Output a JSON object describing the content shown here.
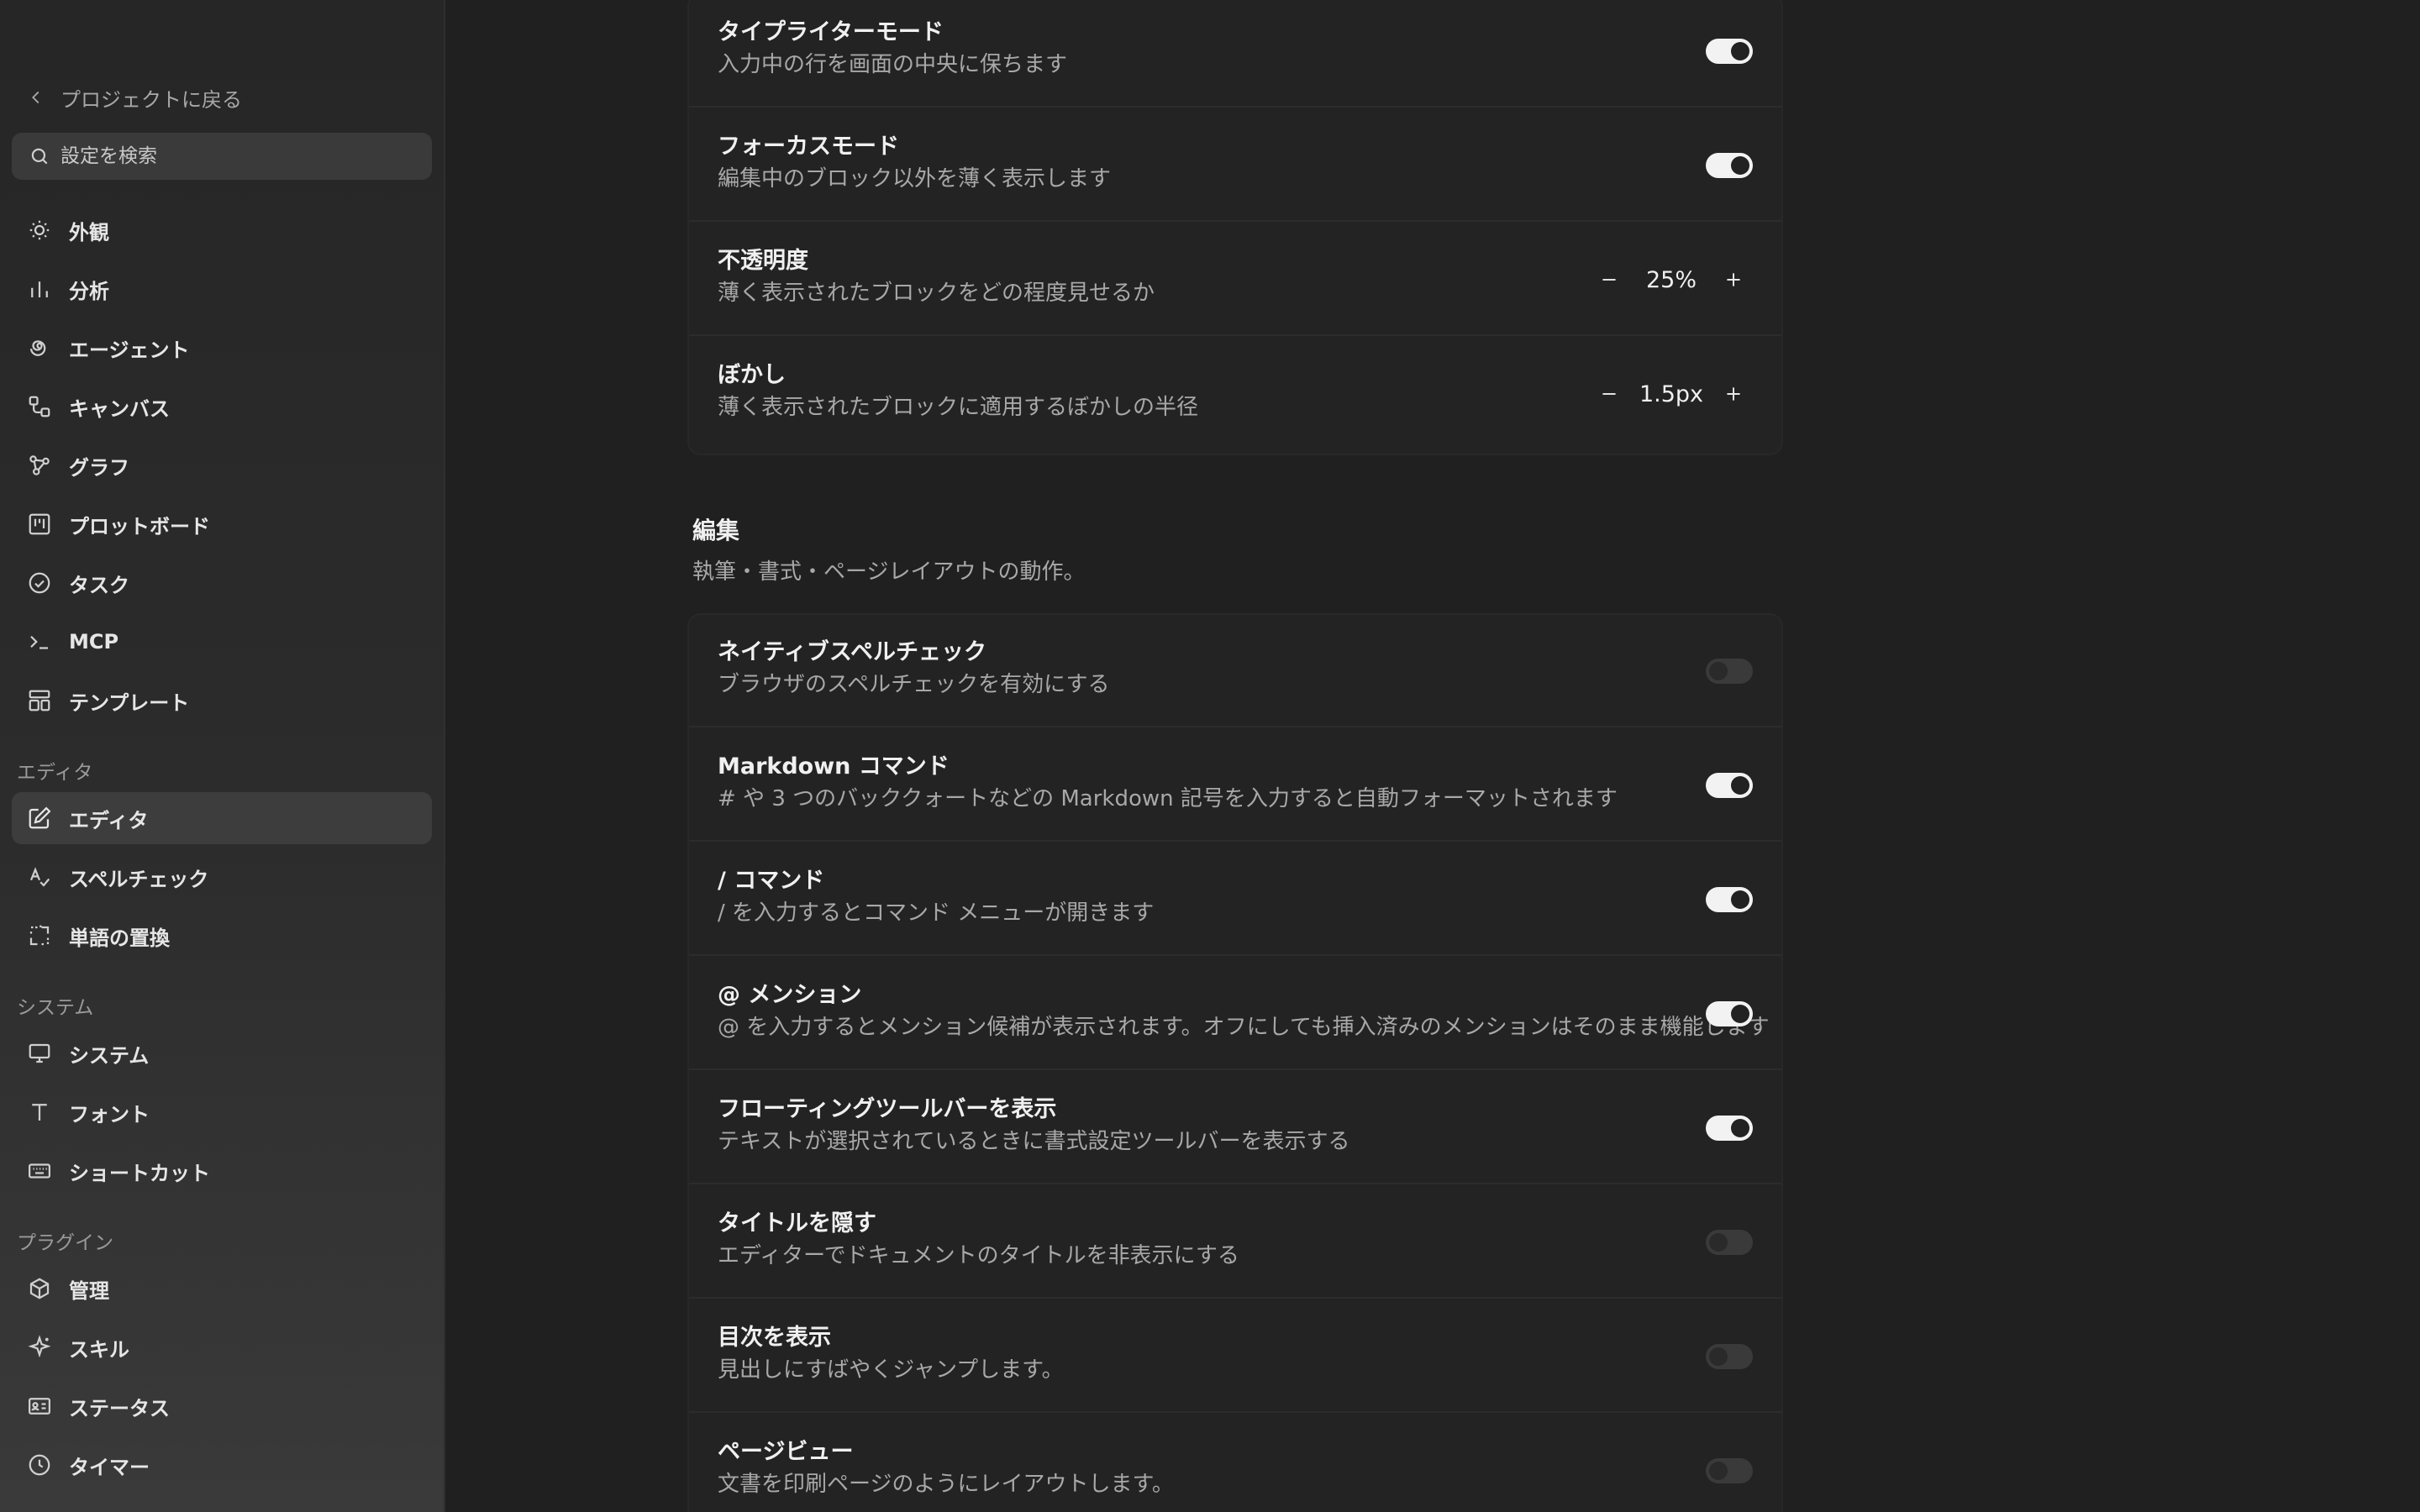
{
  "sidebar": {
    "back_label": "プロジェクトに戻る",
    "search_placeholder": "設定を検索",
    "items_top": [
      {
        "label": "外観",
        "icon": "sun-icon"
      },
      {
        "label": "分析",
        "icon": "bar-chart-icon"
      },
      {
        "label": "エージェント",
        "icon": "spiral-icon"
      },
      {
        "label": "キャンバス",
        "icon": "canvas-icon"
      },
      {
        "label": "グラフ",
        "icon": "graph-icon"
      },
      {
        "label": "プロットボード",
        "icon": "plotboard-icon"
      },
      {
        "label": "タスク",
        "icon": "check-circle-icon"
      },
      {
        "label": "MCP",
        "icon": "terminal-icon"
      },
      {
        "label": "テンプレート",
        "icon": "template-icon"
      }
    ],
    "section_editor": "エディタ",
    "items_editor": [
      {
        "label": "エディタ",
        "icon": "edit-icon",
        "active": true
      },
      {
        "label": "スペルチェック",
        "icon": "spellcheck-icon"
      },
      {
        "label": "単語の置換",
        "icon": "replace-icon"
      }
    ],
    "section_system": "システム",
    "items_system": [
      {
        "label": "システム",
        "icon": "monitor-icon"
      },
      {
        "label": "フォント",
        "icon": "font-icon"
      },
      {
        "label": "ショートカット",
        "icon": "keyboard-icon"
      }
    ],
    "section_plugins": "プラグイン",
    "items_plugins": [
      {
        "label": "管理",
        "icon": "package-icon"
      },
      {
        "label": "スキル",
        "icon": "sparkle-icon"
      },
      {
        "label": "ステータス",
        "icon": "id-card-icon"
      },
      {
        "label": "タイマー",
        "icon": "clock-icon"
      }
    ]
  },
  "focus_panel": {
    "typewriter": {
      "title": "タイプライターモード",
      "desc": "入力中の行を画面の中央に保ちます",
      "enabled": true
    },
    "focus_mode": {
      "title": "フォーカスモード",
      "desc": "編集中のブロック以外を薄く表示します",
      "enabled": true
    },
    "opacity": {
      "title": "不透明度",
      "desc": "薄く表示されたブロックをどの程度見せるか",
      "value": "25%"
    },
    "blur": {
      "title": "ぼかし",
      "desc": "薄く表示されたブロックに適用するぼかしの半径",
      "value": "1.5px"
    }
  },
  "editing_section": {
    "title": "編集",
    "desc": "執筆・書式・ページレイアウトの動作。",
    "rows": [
      {
        "title": "ネイティブスペルチェック",
        "desc": "ブラウザのスペルチェックを有効にする",
        "enabled": false
      },
      {
        "title": "Markdown コマンド",
        "desc": "# や 3 つのバッククォートなどの Markdown 記号を入力すると自動フォーマットされます",
        "enabled": true
      },
      {
        "title": "/ コマンド",
        "desc": "/ を入力するとコマンド メニューが開きます",
        "enabled": true
      },
      {
        "title": "@ メンション",
        "desc": "@ を入力するとメンション候補が表示されます。オフにしても挿入済みのメンションはそのまま機能します",
        "enabled": true
      },
      {
        "title": "フローティングツールバーを表示",
        "desc": "テキストが選択されているときに書式設定ツールバーを表示する",
        "enabled": true
      },
      {
        "title": "タイトルを隠す",
        "desc": "エディターでドキュメントのタイトルを非表示にする",
        "enabled": false
      },
      {
        "title": "目次を表示",
        "desc": "見出しにすばやくジャンプします。",
        "enabled": false
      },
      {
        "title": "ページビュー",
        "desc": "文書を印刷ページのようにレイアウトします。",
        "enabled": false
      }
    ]
  }
}
